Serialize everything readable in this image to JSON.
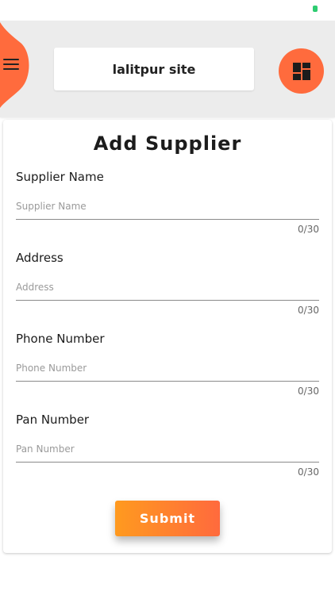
{
  "header": {
    "site_name": "lalitpur site",
    "accent_color": "#ff6b3d",
    "menu_icon": "hamburger-menu-icon",
    "dashboard_icon": "dashboard-grid-icon"
  },
  "form": {
    "title": "Add Supplier",
    "fields": [
      {
        "label": "Supplier Name",
        "placeholder": "Supplier Name",
        "value": "",
        "counter": "0/30"
      },
      {
        "label": "Address",
        "placeholder": "Address",
        "value": "",
        "counter": "0/30"
      },
      {
        "label": "Phone Number",
        "placeholder": "Phone Number",
        "value": "",
        "counter": "0/30"
      },
      {
        "label": "Pan Number",
        "placeholder": "Pan Number",
        "value": "",
        "counter": "0/30"
      }
    ],
    "submit_label": "Submit",
    "submit_gradient": [
      "#ff9a1f",
      "#ff6a3d"
    ]
  }
}
